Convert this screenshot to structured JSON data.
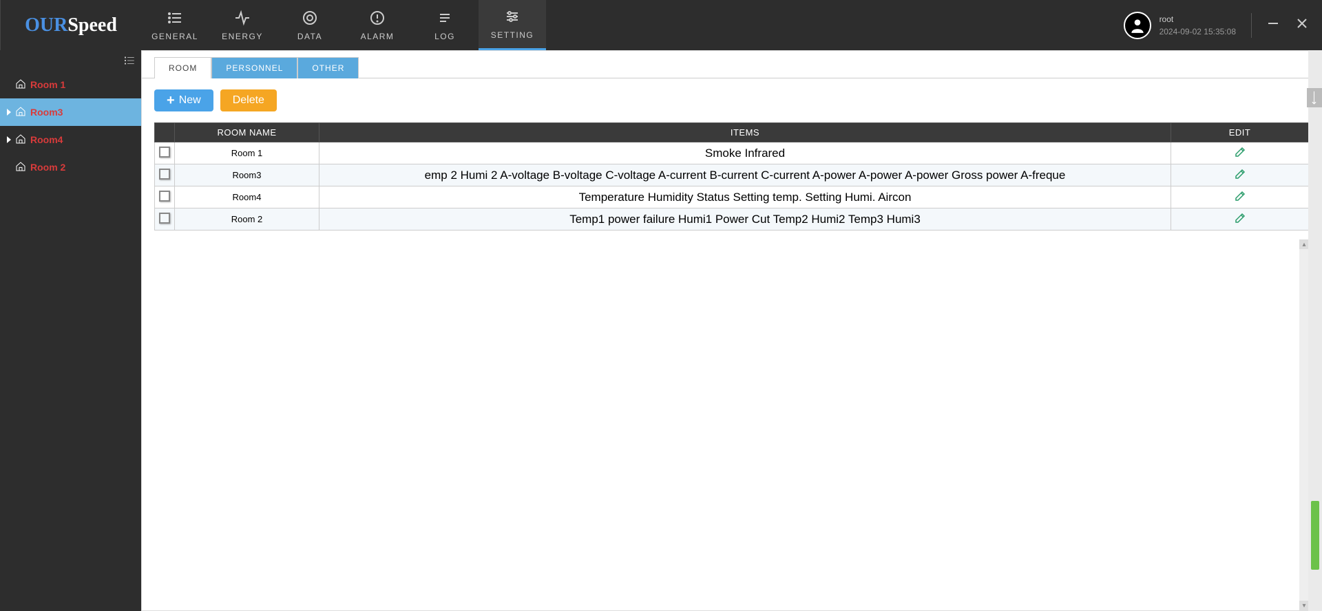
{
  "logo": {
    "part1": "OUR",
    "part2": "Speed"
  },
  "nav": [
    {
      "label": "GENERAL",
      "icon": "list"
    },
    {
      "label": "ENERGY",
      "icon": "activity"
    },
    {
      "label": "DATA",
      "icon": "target"
    },
    {
      "label": "ALARM",
      "icon": "alert"
    },
    {
      "label": "LOG",
      "icon": "lines"
    },
    {
      "label": "SETTING",
      "icon": "sliders",
      "active": true
    }
  ],
  "user": {
    "name": "root",
    "datetime": "2024-09-02 15:35:08"
  },
  "sidebar": {
    "items": [
      {
        "label": "Room 1",
        "triangle": false,
        "active": false
      },
      {
        "label": "Room3",
        "triangle": true,
        "active": true
      },
      {
        "label": "Room4",
        "triangle": true,
        "active": false
      },
      {
        "label": "Room 2",
        "triangle": false,
        "active": false
      }
    ]
  },
  "tabs": [
    {
      "label": "ROOM",
      "active": true
    },
    {
      "label": "PERSONNEL",
      "active": false
    },
    {
      "label": "OTHER",
      "active": false
    }
  ],
  "toolbar": {
    "new_label": "New",
    "delete_label": "Delete"
  },
  "table": {
    "headers": {
      "room": "ROOM NAME",
      "items": "ITEMS",
      "edit": "EDIT"
    },
    "rows": [
      {
        "room": "Room 1",
        "items": "Smoke Infrared"
      },
      {
        "room": "Room3",
        "items": "emp 2 Humi 2 A-voltage B-voltage C-voltage A-current B-current C-current A-power A-power A-power Gross power A-freque"
      },
      {
        "room": "Room4",
        "items": "Temperature Humidity Status Setting temp. Setting Humi. Aircon"
      },
      {
        "room": "Room 2",
        "items": "Temp1 power failure Humi1 Power Cut  Temp2 Humi2 Temp3 Humi3"
      }
    ]
  }
}
